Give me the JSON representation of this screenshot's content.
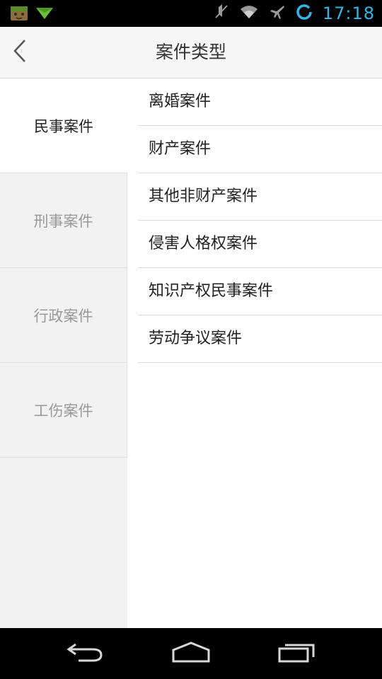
{
  "status_bar": {
    "time": "17:18"
  },
  "header": {
    "title": "案件类型"
  },
  "categories": [
    {
      "label": "民事案件",
      "active": true
    },
    {
      "label": "刑事案件",
      "active": false
    },
    {
      "label": "行政案件",
      "active": false
    },
    {
      "label": "工伤案件",
      "active": false
    }
  ],
  "subtypes": [
    {
      "label": "离婚案件"
    },
    {
      "label": "财产案件"
    },
    {
      "label": "其他非财产案件"
    },
    {
      "label": "侵害人格权案件"
    },
    {
      "label": "知识产权民事案件"
    },
    {
      "label": "劳动争议案件"
    }
  ],
  "icons": {
    "status": [
      "app-notification-icon",
      "paper-plane-icon",
      "mute-icon",
      "wifi-icon",
      "airplane-mode-icon",
      "sync-icon"
    ],
    "nav": [
      "back-nav-icon",
      "home-nav-icon",
      "recent-apps-icon"
    ]
  },
  "colors": {
    "accent": "#33b5e5",
    "selected_bg": "#ffffff",
    "unselected_bg": "#f2f2f2",
    "unselected_text": "#999999"
  }
}
